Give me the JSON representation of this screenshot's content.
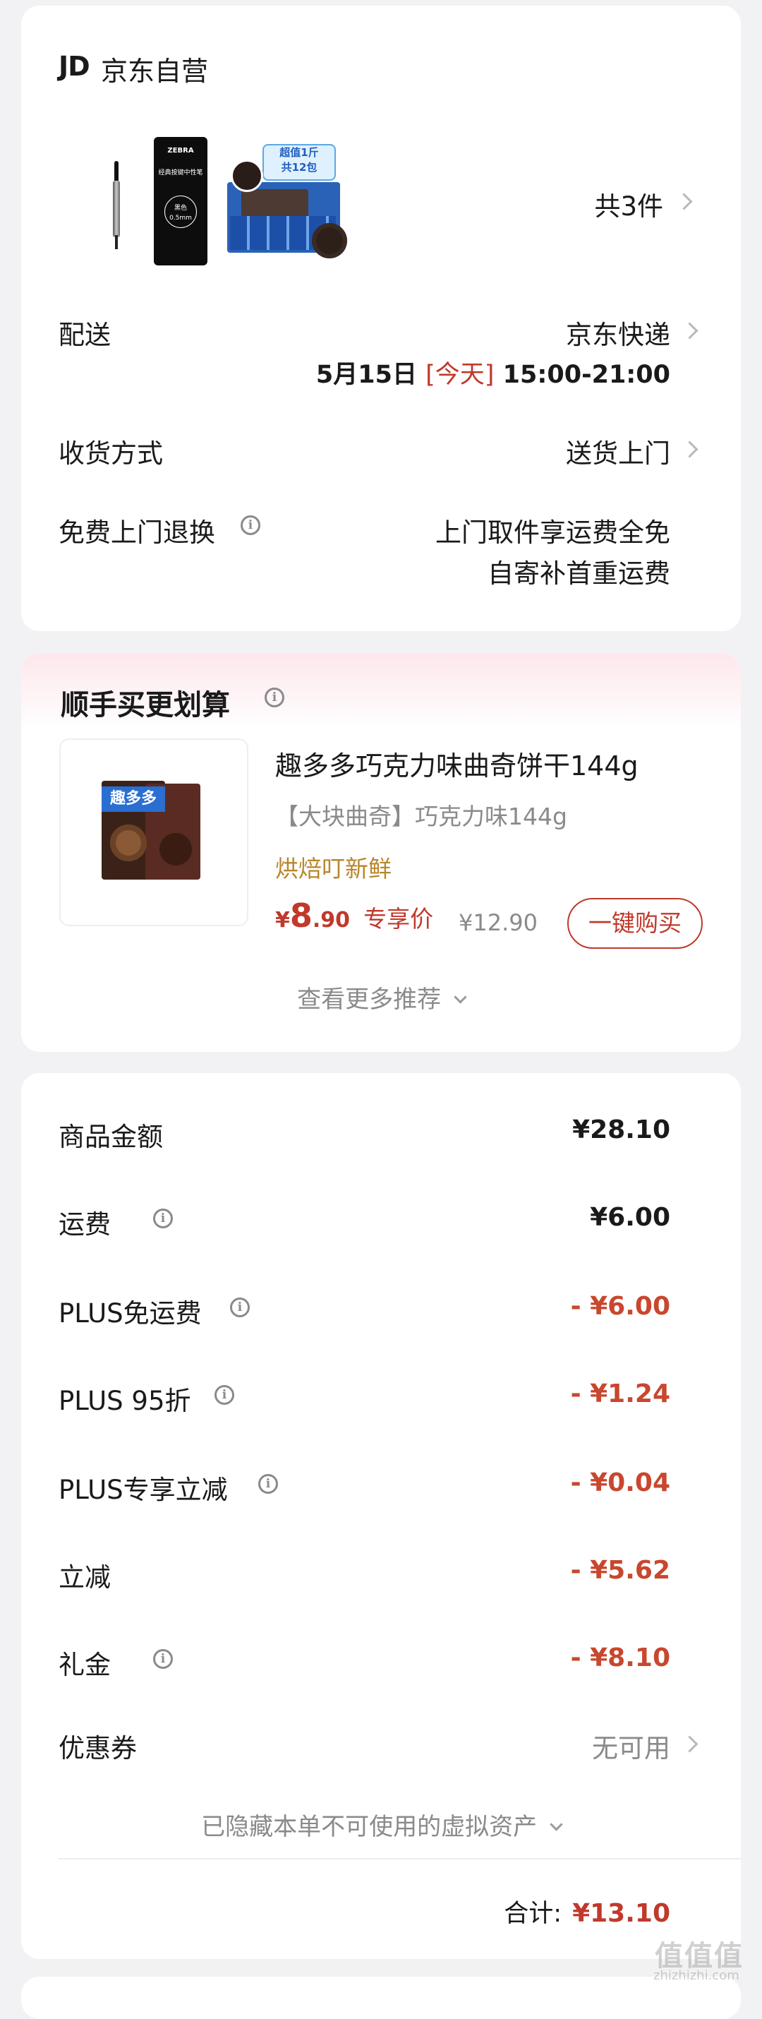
{
  "shipping_card": {
    "brand_logo": "JD",
    "brand_name": "京东自营",
    "item_count": "共3件",
    "pen_box_text": [
      "ZEBRA",
      "经典按键中性笔",
      "黑色",
      "0.5mm"
    ],
    "cookie_box_text": [
      "超值1斤",
      "共12包"
    ],
    "delivery_label": "配送",
    "delivery_value": "京东快递",
    "delivery_date": "5月15日",
    "delivery_today": "[今天]",
    "delivery_time": "15:00-21:00",
    "receive_label": "收货方式",
    "receive_value": "送货上门",
    "return_label": "免费上门退换",
    "return_value_1": "上门取件享运费全免",
    "return_value_2": "自寄补首重运费"
  },
  "recommend_card": {
    "title": "顺手买更划算",
    "product_name": "趣多多巧克力味曲奇饼干144g",
    "product_spec": "【大块曲奇】巧克力味144g",
    "product_tag": "烘焙叮新鲜",
    "price_symbol": "¥",
    "price_int": "8",
    "price_dec": ".90",
    "price_note": "专享价",
    "original_price": "¥12.90",
    "buy_button": "一键购买",
    "more_link": "查看更多推荐",
    "image_text": "趣多多"
  },
  "price_card": {
    "rows": [
      {
        "label": "商品金额",
        "value": "¥28.10"
      },
      {
        "label": "运费",
        "value": "¥6.00"
      },
      {
        "label": "PLUS免运费",
        "value": "- ¥6.00"
      },
      {
        "label": "PLUS 95折",
        "value": "- ¥1.24"
      },
      {
        "label": "PLUS专享立减",
        "value": "- ¥0.04"
      },
      {
        "label": "立减",
        "value": "- ¥5.62"
      },
      {
        "label": "礼金",
        "value": "- ¥8.10"
      }
    ],
    "coupon_label": "优惠券",
    "coupon_value": "无可用",
    "hidden_assets": "已隐藏本单不可使用的虚拟资产",
    "total_label": "合计:",
    "total_value": "¥13.10"
  },
  "watermark": {
    "logo": "值值值",
    "url": "zhizhizhi.com"
  },
  "colors": {
    "accent_red": "#c0392b",
    "tag_gold": "#b8862b",
    "card_bg": "#ffffff",
    "page_bg": "#f2f2f4"
  }
}
